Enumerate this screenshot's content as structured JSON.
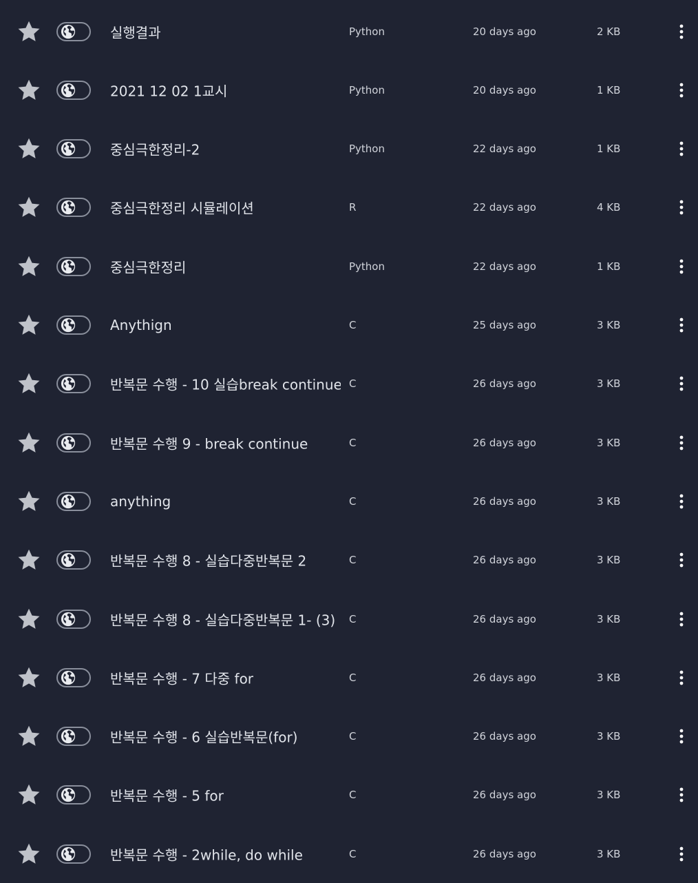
{
  "colors": {
    "background": "#1f2332",
    "star": "#bfc2c9",
    "text": "#e1e4ea",
    "muted_text": "#d0d3da",
    "toggle_border": "#8a8f9c"
  },
  "icons": {
    "star": "star-icon",
    "visibility": "globe-icon",
    "menu": "more-vertical-icon"
  },
  "items": [
    {
      "name": "실행결과",
      "language": "Python",
      "modified": "20 days ago",
      "size": "2 KB"
    },
    {
      "name": "2021 12 02 1교시",
      "language": "Python",
      "modified": "20 days ago",
      "size": "1 KB"
    },
    {
      "name": "중심극한정리-2",
      "language": "Python",
      "modified": "22 days ago",
      "size": "1 KB"
    },
    {
      "name": "중심극한정리 시뮬레이션",
      "language": "R",
      "modified": "22 days ago",
      "size": "4 KB"
    },
    {
      "name": "중심극한정리",
      "language": "Python",
      "modified": "22 days ago",
      "size": "1 KB"
    },
    {
      "name": "Anythign",
      "language": "C",
      "modified": "25 days ago",
      "size": "3 KB"
    },
    {
      "name": "반복문 수행 - 10 실습break continue",
      "language": "C",
      "modified": "26 days ago",
      "size": "3 KB"
    },
    {
      "name": "반복문 수행 9 - break continue",
      "language": "C",
      "modified": "26 days ago",
      "size": "3 KB"
    },
    {
      "name": "anything",
      "language": "C",
      "modified": "26 days ago",
      "size": "3 KB"
    },
    {
      "name": "반복문 수행 8 - 실습다중반복문 2",
      "language": "C",
      "modified": "26 days ago",
      "size": "3 KB"
    },
    {
      "name": "반복문 수행 8 - 실습다중반복문 1- (3)",
      "language": "C",
      "modified": "26 days ago",
      "size": "3 KB"
    },
    {
      "name": "반복문 수행 - 7 다중 for",
      "language": "C",
      "modified": "26 days ago",
      "size": "3 KB"
    },
    {
      "name": "반복문 수행 - 6 실습반복문(for)",
      "language": "C",
      "modified": "26 days ago",
      "size": "3 KB"
    },
    {
      "name": "반복문 수행 - 5 for",
      "language": "C",
      "modified": "26 days ago",
      "size": "3 KB"
    },
    {
      "name": "반복문 수행 - 2while, do while",
      "language": "C",
      "modified": "26 days ago",
      "size": "3 KB"
    }
  ]
}
